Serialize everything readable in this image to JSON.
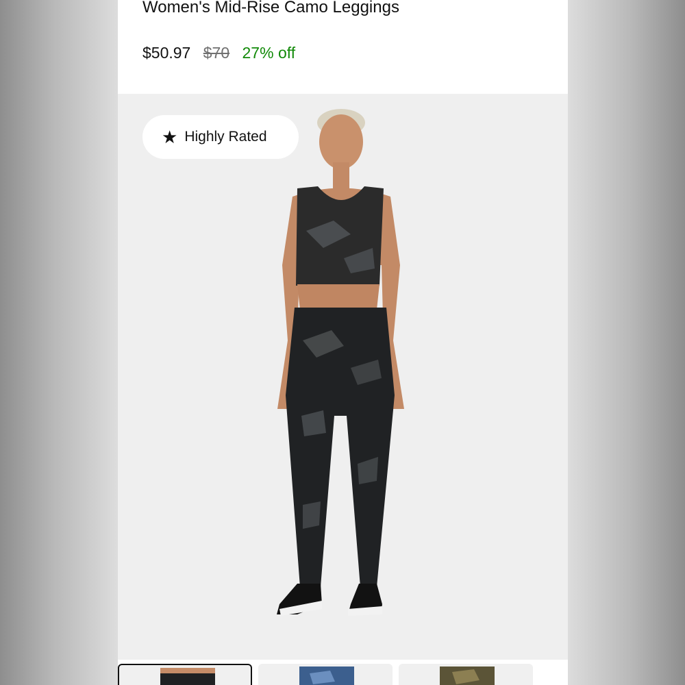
{
  "product": {
    "title": "Women's Mid-Rise Camo Leggings",
    "price_current": "$50.97",
    "price_original": "$70",
    "discount": "27% off"
  },
  "hero": {
    "badge_label": "Highly Rated",
    "badge_icon": "star-icon"
  },
  "thumbnails": [
    {
      "variant": "black camo",
      "selected": true
    },
    {
      "variant": "blue camo",
      "selected": false
    },
    {
      "variant": "olive camo",
      "selected": false
    }
  ],
  "colors": {
    "discount": "#128a09",
    "price_original": "#707070",
    "hero_background": "#efefef"
  }
}
